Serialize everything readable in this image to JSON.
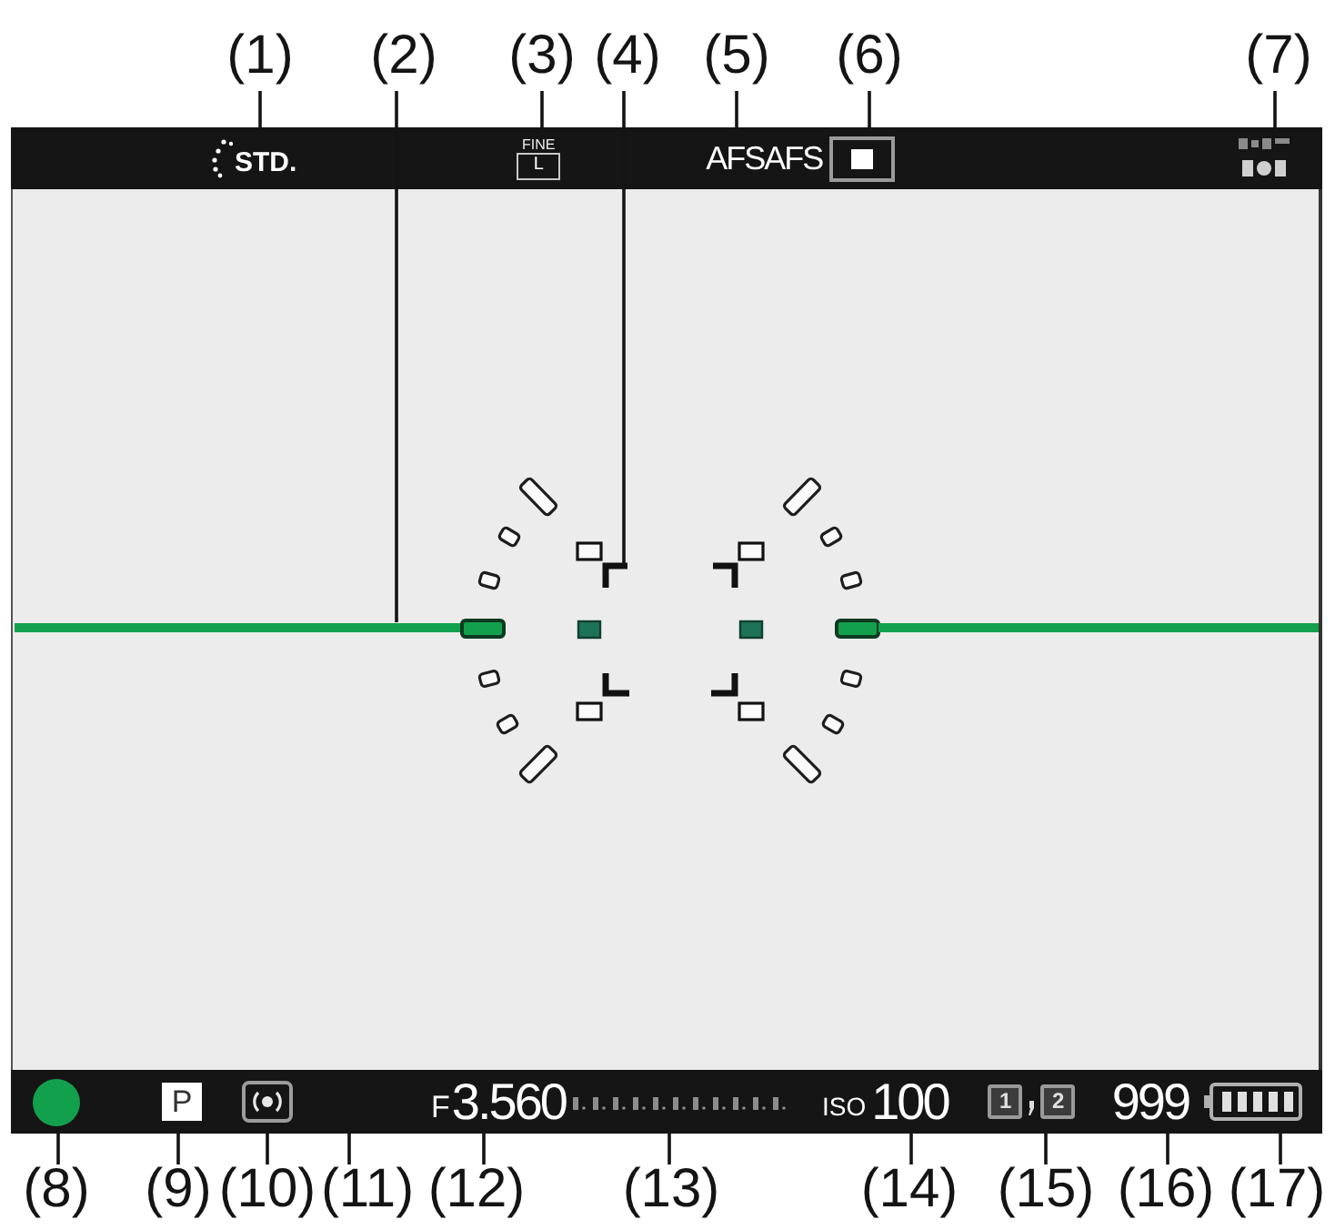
{
  "callouts_top": [
    "(1)",
    "(2)",
    "(3)",
    "(4)",
    "(5)",
    "(6)",
    "(7)"
  ],
  "top_bar": {
    "picture_style": "STD.",
    "quality_label": "FINE",
    "image_size": "L",
    "af_mode": "AFSAFS"
  },
  "bottom_bar": {
    "shooting_mode": "P",
    "aperture_prefix": "F",
    "exposure_reading": "3.560",
    "iso_prefix": "ISO",
    "iso_value": "100",
    "card_slots": [
      "1",
      "2"
    ],
    "shots_remaining": "999"
  },
  "callouts_bottom": [
    "(8)",
    "(9)",
    "(10)",
    "(11)",
    "(12)",
    "(13)",
    "(14)",
    "(15)",
    "(16)",
    "(17)"
  ]
}
